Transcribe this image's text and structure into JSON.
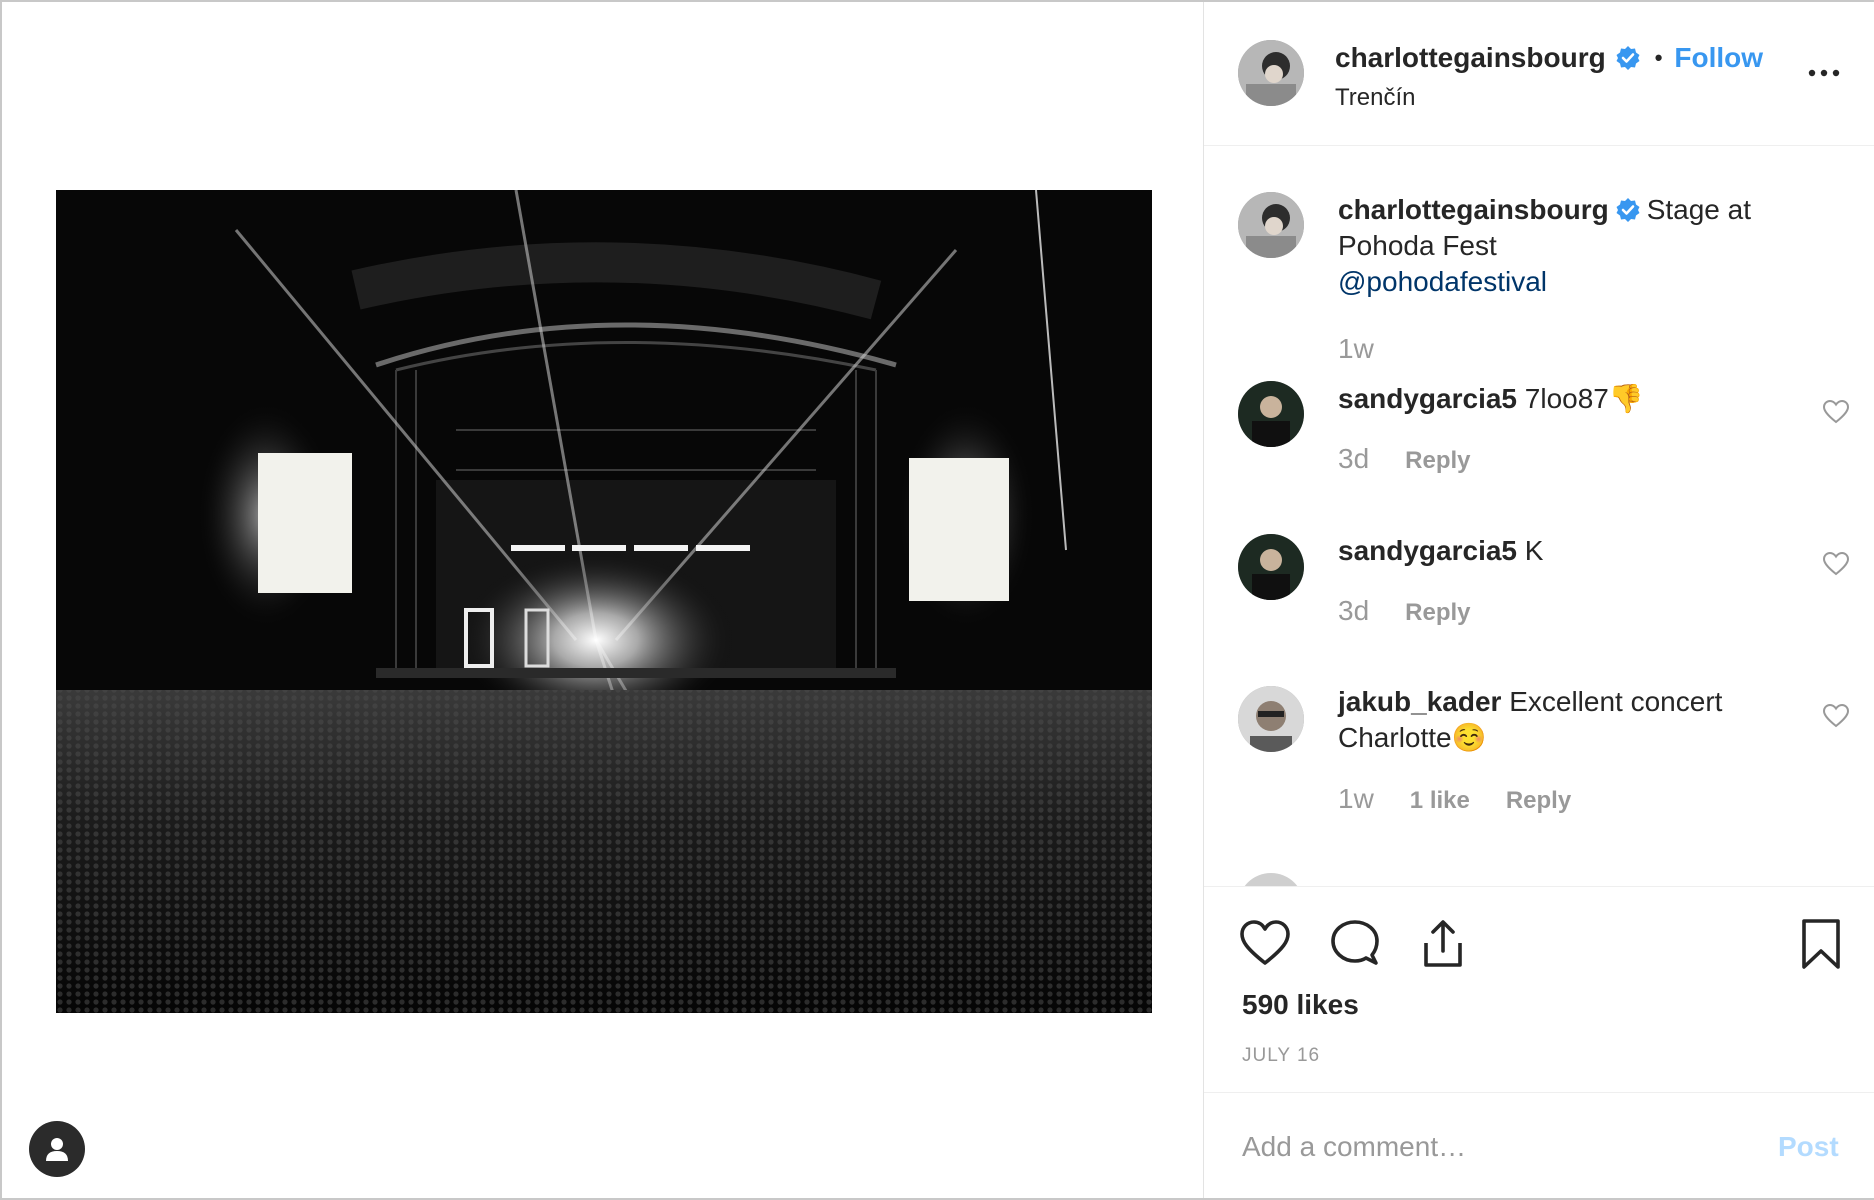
{
  "header": {
    "username": "charlottegainsbourg",
    "separator": "•",
    "follow_label": "Follow",
    "location": "Trenčín",
    "more_icon": "more-horizontal-icon"
  },
  "caption": {
    "username": "charlottegainsbourg",
    "text": "Stage at Pohoda Fest",
    "mention": "@pohodafestival",
    "age": "1w"
  },
  "comments": [
    {
      "username": "sandygarcia5",
      "text": "7loo87",
      "emoji": "👎",
      "age": "3d",
      "likes_label": "",
      "reply_label": "Reply"
    },
    {
      "username": "sandygarcia5",
      "text": "K",
      "emoji": "",
      "age": "3d",
      "likes_label": "",
      "reply_label": "Reply"
    },
    {
      "username": "jakub_kader",
      "text": "Excellent concert Charlotte",
      "emoji": "☺️",
      "age": "1w",
      "likes_label": "1 like",
      "reply_label": "Reply"
    }
  ],
  "actions": {
    "likes": "590 likes",
    "date": "JULY 16"
  },
  "add_comment": {
    "placeholder": "Add a comment…",
    "post_label": "Post"
  },
  "colors": {
    "accent": "#3897f0",
    "verified": "#3897f0",
    "mention": "#003569",
    "muted": "#999999",
    "post_disabled": "#b3dbff"
  },
  "photo": {
    "description_icon": "concert-stage-photo"
  }
}
